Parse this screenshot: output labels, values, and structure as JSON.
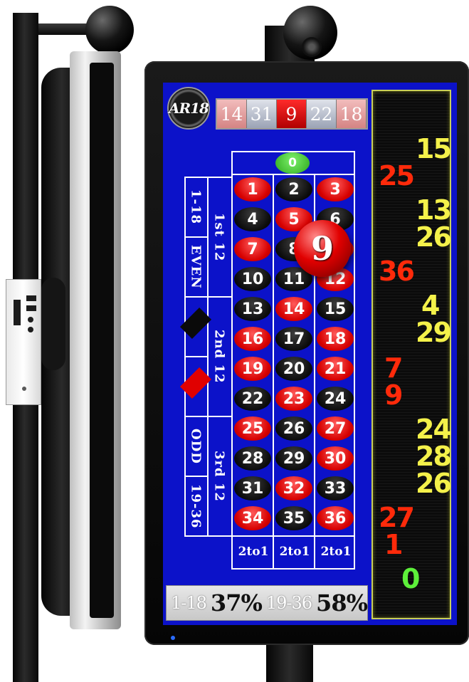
{
  "logo": {
    "text": "AR18"
  },
  "recent_results": [
    {
      "value": "14",
      "color": "red"
    },
    {
      "value": "31",
      "color": "black"
    },
    {
      "value": "9",
      "color": "hot"
    },
    {
      "value": "22",
      "color": "black"
    },
    {
      "value": "18",
      "color": "red"
    }
  ],
  "board": {
    "zero": "0",
    "winning_number": "9",
    "rows": [
      [
        {
          "n": "1",
          "c": "r"
        },
        {
          "n": "2",
          "c": "b"
        },
        {
          "n": "3",
          "c": "r"
        }
      ],
      [
        {
          "n": "4",
          "c": "b"
        },
        {
          "n": "5",
          "c": "r"
        },
        {
          "n": "6",
          "c": "b"
        }
      ],
      [
        {
          "n": "7",
          "c": "r"
        },
        {
          "n": "8",
          "c": "b"
        },
        {
          "n": "9",
          "c": "r"
        }
      ],
      [
        {
          "n": "10",
          "c": "b"
        },
        {
          "n": "11",
          "c": "b"
        },
        {
          "n": "12",
          "c": "r"
        }
      ],
      [
        {
          "n": "13",
          "c": "b"
        },
        {
          "n": "14",
          "c": "r"
        },
        {
          "n": "15",
          "c": "b"
        }
      ],
      [
        {
          "n": "16",
          "c": "r"
        },
        {
          "n": "17",
          "c": "b"
        },
        {
          "n": "18",
          "c": "r"
        }
      ],
      [
        {
          "n": "19",
          "c": "r"
        },
        {
          "n": "20",
          "c": "b"
        },
        {
          "n": "21",
          "c": "r"
        }
      ],
      [
        {
          "n": "22",
          "c": "b"
        },
        {
          "n": "23",
          "c": "r"
        },
        {
          "n": "24",
          "c": "b"
        }
      ],
      [
        {
          "n": "25",
          "c": "r"
        },
        {
          "n": "26",
          "c": "b"
        },
        {
          "n": "27",
          "c": "r"
        }
      ],
      [
        {
          "n": "28",
          "c": "b"
        },
        {
          "n": "29",
          "c": "b"
        },
        {
          "n": "30",
          "c": "r"
        }
      ],
      [
        {
          "n": "31",
          "c": "b"
        },
        {
          "n": "32",
          "c": "r"
        },
        {
          "n": "33",
          "c": "b"
        }
      ],
      [
        {
          "n": "34",
          "c": "r"
        },
        {
          "n": "35",
          "c": "b"
        },
        {
          "n": "36",
          "c": "r"
        }
      ]
    ],
    "dozens": [
      "1st 12",
      "2nd 12",
      "3rd 12"
    ],
    "outside_bets": [
      "1-18",
      "EVEN",
      "ODD",
      "19-36"
    ],
    "columns": [
      "2to1",
      "2to1",
      "2to1"
    ]
  },
  "stats": {
    "low_label": "1-18",
    "low_value": "37%",
    "high_label": "19-36",
    "high_value": "58%"
  },
  "history_column": [
    {
      "value": "15",
      "color": "black"
    },
    {
      "value": "25",
      "color": "red"
    },
    {
      "value": "13",
      "color": "black"
    },
    {
      "value": "26",
      "color": "black"
    },
    {
      "value": "36",
      "color": "red"
    },
    {
      "value": "4",
      "color": "black"
    },
    {
      "value": "29",
      "color": "black"
    },
    {
      "value": "7",
      "color": "red"
    },
    {
      "value": "9",
      "color": "red"
    },
    {
      "value": "24",
      "color": "black"
    },
    {
      "value": "28",
      "color": "black"
    },
    {
      "value": "26",
      "color": "black"
    },
    {
      "value": "27",
      "color": "red"
    },
    {
      "value": "1",
      "color": "red"
    },
    {
      "value": "0",
      "color": "green"
    }
  ],
  "colors": {
    "screen_blue": "#0c12c9",
    "red": "#d60000",
    "black_num": "#0a0a0a",
    "zero_green": "#2da81c",
    "history_black": "#f4f14a",
    "history_red": "#ff2a0a"
  }
}
